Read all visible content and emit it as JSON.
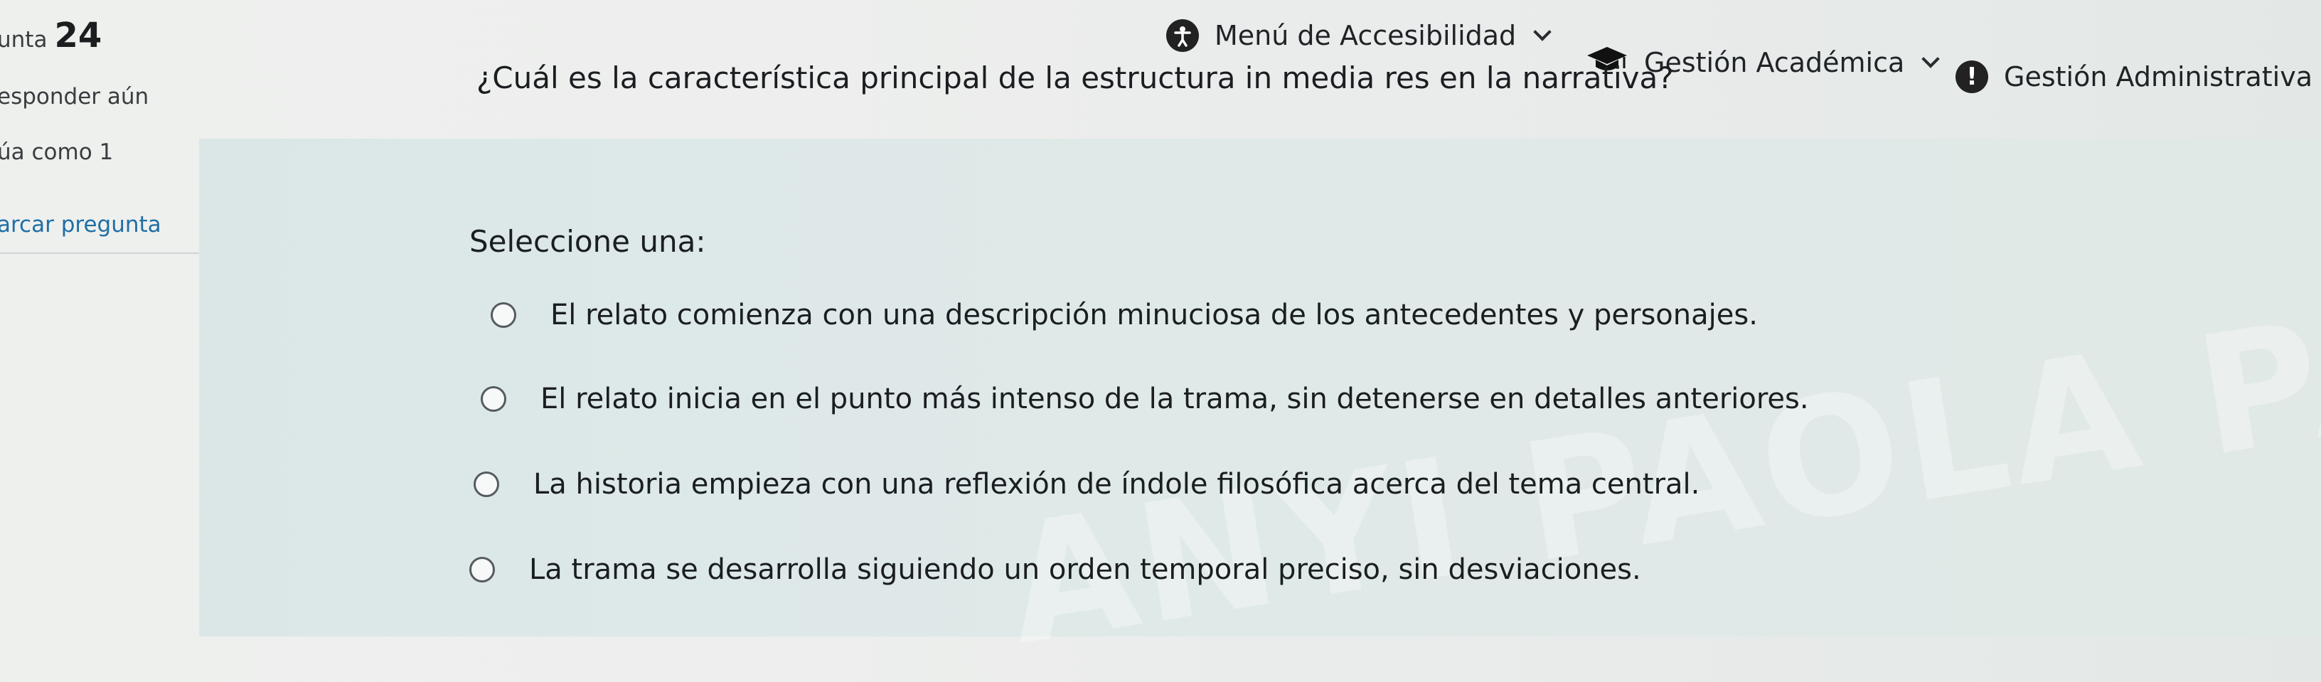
{
  "nav": {
    "accessibility_label": "Menú de Accesibilidad",
    "academic_label": "Gestión Académica",
    "admin_label": "Gestión Administrativa"
  },
  "question_info": {
    "label": "unta",
    "number": "24",
    "state": "esponder aún",
    "grade": "úa como 1",
    "flag": "arcar pregunta"
  },
  "question": {
    "text": "¿Cuál es la característica principal de la estructura in media res en la narrativa?",
    "prompt": "Seleccione una:",
    "answers": [
      {
        "text": "El relato comienza con una descripción minuciosa de los antecedentes y personajes."
      },
      {
        "text": "El relato inicia en el punto más intenso de la trama, sin detenerse en detalles anteriores."
      },
      {
        "text": "La historia empieza con una reflexión de índole filosófica acerca del tema central."
      },
      {
        "text": "La trama se desarrolla siguiendo un orden temporal preciso, sin desviaciones."
      }
    ]
  },
  "watermark": "ANYI PAOLA PALACIOS PALA",
  "icons": {
    "accessibility": "accessibility-icon",
    "academic": "graduation-cap-icon",
    "admin": "alert-icon"
  }
}
